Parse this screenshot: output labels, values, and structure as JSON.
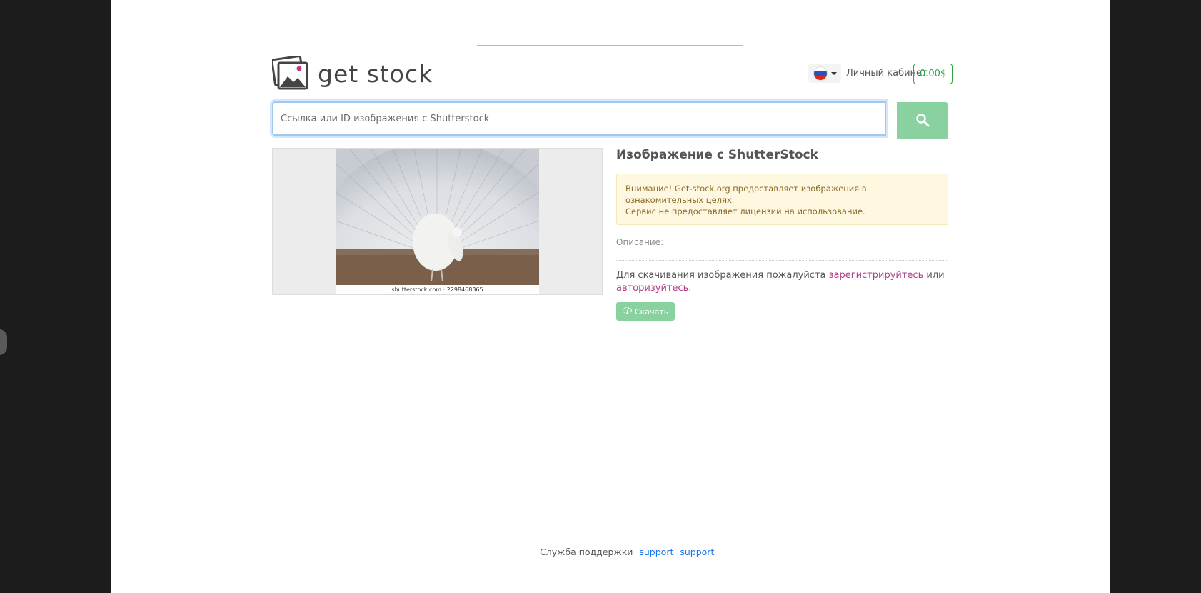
{
  "brand": {
    "logo_text": "get stock"
  },
  "header": {
    "language_flag": "ru-flag-icon",
    "cabinet_label": "Личный кабинет",
    "balance": "0.00$"
  },
  "search": {
    "placeholder": "Ссылка или ID изображения с Shutterstock",
    "value": "",
    "button_icon": "search-icon"
  },
  "image": {
    "caption": "shutterstock.com · 2298468365"
  },
  "info": {
    "title": "Изображение с ShutterStock",
    "alert_line1": "Внимание! Get-stock.org предоставляет изображения в ознакомительных целях.",
    "alert_line2": "Сервис не предоставляет лицензий на использование.",
    "description_label": "Описание:",
    "notice_prefix": "Для скачивания изображения пожалуйста",
    "register_link": "зарегистрируйтесь",
    "notice_or": "или",
    "login_link": "авторизуйтесь.",
    "download_label": "Скачать"
  },
  "footer": {
    "support_label": "Служба поддержки",
    "link1": "support",
    "link2": "support"
  },
  "colors": {
    "accent_green": "#8ad1a0",
    "balance_green": "#28a745",
    "link_magenta": "#b03f89",
    "alert_bg": "#fff8e1"
  }
}
